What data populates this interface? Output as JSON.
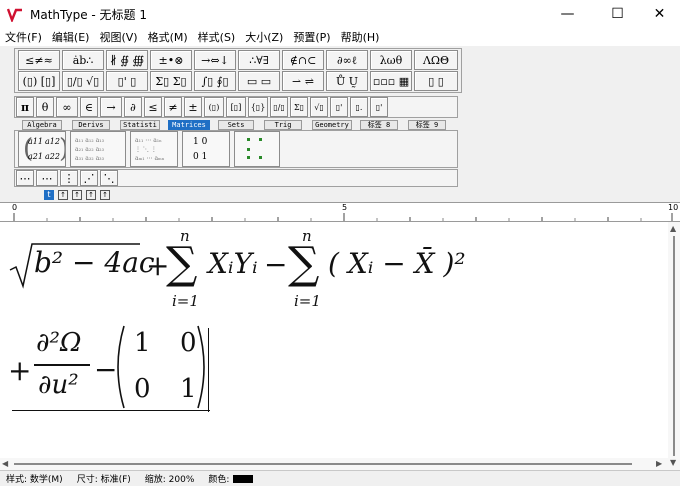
{
  "window": {
    "title": "MathType - 无标题 1",
    "minimize": "—",
    "maximize": "☐",
    "close": "✕"
  },
  "menu": [
    "文件(F)",
    "编辑(E)",
    "视图(V)",
    "格式(M)",
    "样式(S)",
    "大小(Z)",
    "预置(P)",
    "帮助(H)"
  ],
  "palette_row1": [
    "≤≠≈",
    "ȧb∴",
    "∦ ∯ ∰",
    "±•⊗",
    "→⇔↓",
    "∴∀∃",
    "∉∩⊂",
    "∂∞ℓ",
    "λωθ",
    "ΛΩΘ"
  ],
  "palette_row2": [
    "(▯) [▯]",
    "▯/▯ √▯",
    "▯' ▯",
    "Σ▯ Σ▯",
    "∫▯ ∮▯",
    "▭ ▭",
    "⇀ ⇌",
    "Ů Ṵ",
    "▫▫▫ ▦",
    "▯ ▯"
  ],
  "small_row": [
    "π",
    "θ",
    "∞",
    "∈",
    "→",
    "∂",
    "≤",
    "≠",
    "±",
    "(▯)",
    "[▯]",
    "{▯}",
    "▯/▯",
    "Σ▯",
    "√▯",
    "▯'",
    "▯.",
    "▯'"
  ],
  "tabs": [
    "Algebra",
    "Derivs",
    "Statisti",
    "Matrices",
    "Sets",
    "Trig",
    "Geometry",
    "标签 8",
    "标签 9"
  ],
  "templates": {
    "t1": {
      "a11": "a11",
      "a12": "a12",
      "a21": "a21",
      "a22": "a22"
    },
    "t4": {
      "r1": "1  0",
      "r2": "0  1"
    }
  },
  "dots_row": [
    "⋯",
    "⋯",
    "⋮",
    "⋰",
    "⋱"
  ],
  "ruler": {
    "marks": [
      "0",
      "5",
      "10"
    ]
  },
  "formula": {
    "line1": {
      "sqrt_body": "b² − 4ac",
      "plus1": "+",
      "sum1_top": "n",
      "sum1_bottom": "i=1",
      "term1": "XᵢYᵢ",
      "minus1": "−",
      "sum2_top": "n",
      "sum2_bottom": "i=1",
      "term2": "( Xᵢ − X̄ )²"
    },
    "line2": {
      "plus2": "+",
      "frac_num": "∂²Ω",
      "frac_den": "∂u²",
      "minus2": "−",
      "matrix": [
        [
          "1",
          "0"
        ],
        [
          "0",
          "1"
        ]
      ]
    }
  },
  "status": {
    "style": "样式: 数学(M)",
    "size": "尺寸: 标准(F)",
    "zoom": "缩放: 200%",
    "color": "颜色:"
  },
  "colors": {
    "tab_active": "#1f6fc5",
    "logo": "#d01030"
  }
}
